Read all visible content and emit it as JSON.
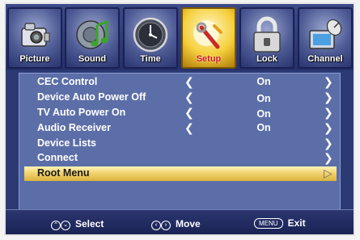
{
  "tabs": [
    {
      "label": "Picture",
      "icon": "camera-icon"
    },
    {
      "label": "Sound",
      "icon": "music-note-icon"
    },
    {
      "label": "Time",
      "icon": "clock-icon"
    },
    {
      "label": "Setup",
      "icon": "wrench-icon",
      "active": true
    },
    {
      "label": "Lock",
      "icon": "padlock-icon"
    },
    {
      "label": "Channel",
      "icon": "satellite-dish-icon"
    }
  ],
  "menu": {
    "items": [
      {
        "label": "CEC Control",
        "value": "On"
      },
      {
        "label": "Device Auto Power Off",
        "value": "On"
      },
      {
        "label": "TV Auto Power On",
        "value": "On"
      },
      {
        "label": "Audio Receiver",
        "value": "On"
      },
      {
        "label": "Device Lists"
      },
      {
        "label": "Connect"
      },
      {
        "label": "Root Menu",
        "selected": true
      }
    ],
    "left_arrow": "❮",
    "right_arrow": "❯",
    "selected_arrow": "▷"
  },
  "footer": {
    "select": {
      "keys": [
        "⌃",
        "⌄"
      ],
      "label": "Select"
    },
    "move": {
      "keys": [
        "‹",
        "›"
      ],
      "label": "Move"
    },
    "exit": {
      "key": "MENU",
      "label": "Exit"
    }
  },
  "colors": {
    "frame_bg": "#2c3a74",
    "menu_bg": "#5c6ea8",
    "highlight": "#f1d470",
    "active_tab": "#f5cf3c",
    "active_tab_label": "#cf1a1a"
  }
}
